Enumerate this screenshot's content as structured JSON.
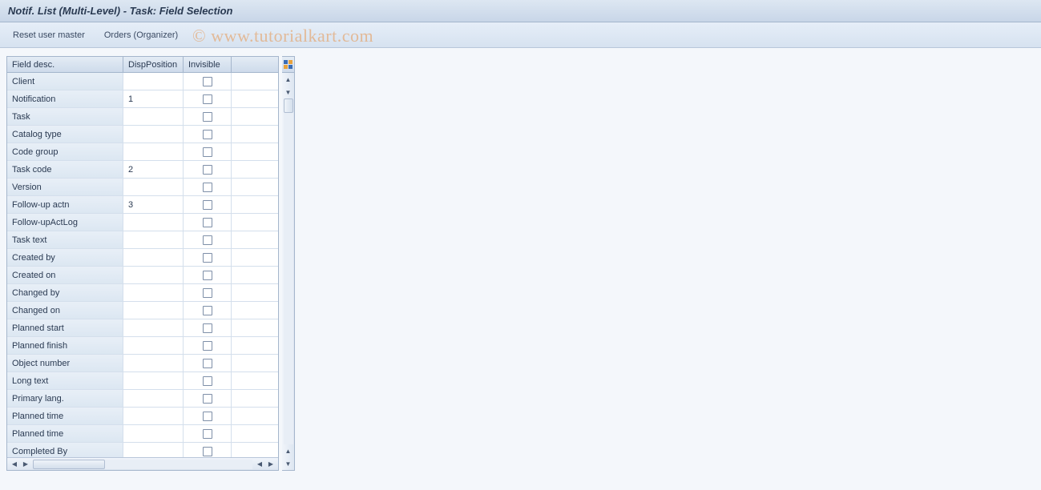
{
  "title": "Notif. List (Multi-Level) - Task: Field Selection",
  "toolbar": {
    "reset": "Reset user master",
    "orders": "Orders (Organizer)"
  },
  "watermark": "© www.tutorialkart.com",
  "table": {
    "headers": {
      "desc": "Field desc.",
      "pos": "DispPosition",
      "inv": "Invisible"
    },
    "rows": [
      {
        "desc": "Client",
        "pos": "",
        "inv": false
      },
      {
        "desc": "Notification",
        "pos": "1",
        "inv": false
      },
      {
        "desc": "Task",
        "pos": "",
        "inv": false
      },
      {
        "desc": "Catalog type",
        "pos": "",
        "inv": false
      },
      {
        "desc": "Code group",
        "pos": "",
        "inv": false
      },
      {
        "desc": "Task code",
        "pos": "2",
        "inv": false
      },
      {
        "desc": "Version",
        "pos": "",
        "inv": false
      },
      {
        "desc": "Follow-up actn",
        "pos": "3",
        "inv": false
      },
      {
        "desc": "Follow-upActLog",
        "pos": "",
        "inv": false
      },
      {
        "desc": "Task text",
        "pos": "",
        "inv": false
      },
      {
        "desc": "Created by",
        "pos": "",
        "inv": false
      },
      {
        "desc": "Created on",
        "pos": "",
        "inv": false
      },
      {
        "desc": "Changed by",
        "pos": "",
        "inv": false
      },
      {
        "desc": "Changed on",
        "pos": "",
        "inv": false
      },
      {
        "desc": "Planned start",
        "pos": "",
        "inv": false
      },
      {
        "desc": "Planned finish",
        "pos": "",
        "inv": false
      },
      {
        "desc": "Object number",
        "pos": "",
        "inv": false
      },
      {
        "desc": "Long text",
        "pos": "",
        "inv": false
      },
      {
        "desc": "Primary lang.",
        "pos": "",
        "inv": false
      },
      {
        "desc": "Planned time",
        "pos": "",
        "inv": false
      },
      {
        "desc": "Planned time",
        "pos": "",
        "inv": false
      },
      {
        "desc": "Completed By",
        "pos": "",
        "inv": false
      }
    ]
  }
}
